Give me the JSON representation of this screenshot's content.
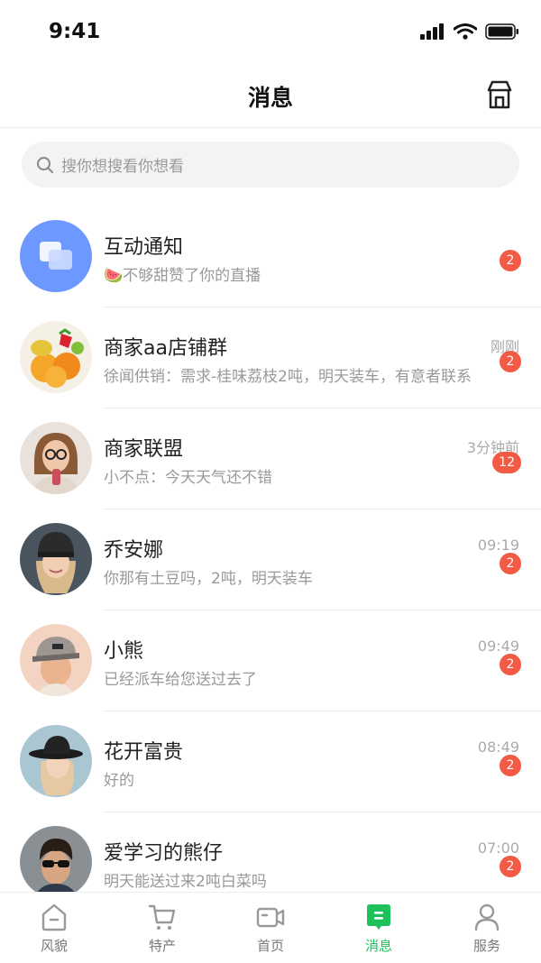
{
  "status": {
    "time": "9:41"
  },
  "header": {
    "title": "消息",
    "action_icon": "shop-icon"
  },
  "search": {
    "placeholder": "搜你想搜看你想看"
  },
  "conversations": [
    {
      "name": "互动通知",
      "message": "🍉不够甜赞了你的直播",
      "time": "",
      "badge": "2",
      "avatar": "notification-icon"
    },
    {
      "name": "商家aa店铺群",
      "message": "徐闻供销：需求-桂味荔枝2吨，明天装车，有意者联系",
      "time": "刚刚",
      "badge": "2",
      "avatar": "fruit-photo"
    },
    {
      "name": "商家联盟",
      "message": "小不点：今天天气还不错",
      "time": "3分钟前",
      "badge": "12",
      "avatar": "woman-glasses-photo"
    },
    {
      "name": "乔安娜",
      "message": "你那有土豆吗，2吨，明天装车",
      "time": "09:19",
      "badge": "2",
      "avatar": "woman-beanie-photo"
    },
    {
      "name": "小熊",
      "message": "已经派车给您送过去了",
      "time": "09:49",
      "badge": "2",
      "avatar": "man-cap-photo"
    },
    {
      "name": "花开富贵",
      "message": "好的",
      "time": "08:49",
      "badge": "2",
      "avatar": "woman-hat-photo"
    },
    {
      "name": "爱学习的熊仔",
      "message": "明天能送过来2吨白菜吗",
      "time": "07:00",
      "badge": "2",
      "avatar": "man-sunglasses-photo"
    }
  ],
  "tabs": [
    {
      "label": "风貌",
      "icon": "house-icon"
    },
    {
      "label": "特产",
      "icon": "cart-icon"
    },
    {
      "label": "首页",
      "icon": "video-icon"
    },
    {
      "label": "消息",
      "icon": "message-icon",
      "active": true
    },
    {
      "label": "服务",
      "icon": "person-icon"
    }
  ],
  "colors": {
    "accent": "#1ec15a",
    "badge": "#f25a44",
    "notify_avatar": "#6c98ff"
  }
}
